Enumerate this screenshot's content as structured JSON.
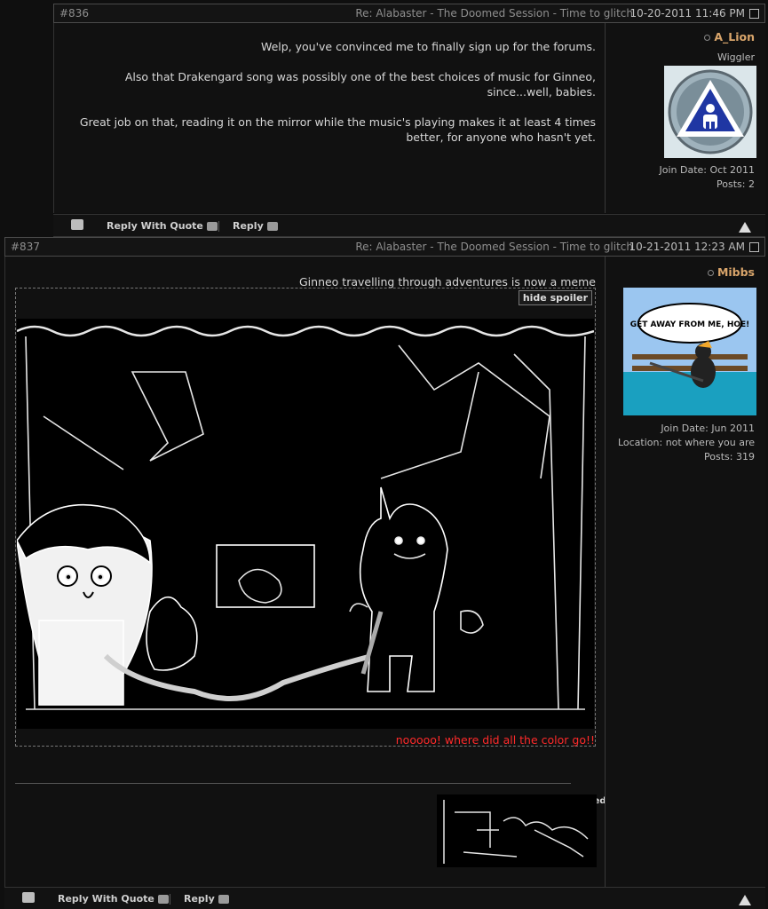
{
  "posts": [
    {
      "number": "#836",
      "datetime": "10-20-2011 11:46 PM",
      "title": "Re: Alabaster - The Doomed Session - Time to glitch",
      "message": [
        "Welp, you've convinced me to finally sign up for the forums.",
        "Also that Drakengard song was possibly one of the best choices of music for Ginneo, since...well, babies.",
        "Great job on that, reading it on the mirror while the music's playing makes it at least 4 times better, for anyone who hasn't yet."
      ],
      "user": {
        "name": "A_Lion",
        "title": "Wiggler",
        "join_label": "Join Date:",
        "join_value": "Oct 2011",
        "posts_label": "Posts:",
        "posts_value": "2"
      },
      "footer": {
        "reply": "Reply",
        "reply_quote": "Reply With Quote"
      }
    },
    {
      "number": "#837",
      "datetime": "10-21-2011 12:23 AM",
      "title": "Re: Alabaster - The Doomed Session - Time to glitch",
      "message_line": "Ginneo travelling through adventures is now a meme",
      "spoiler_button": "hide spoiler",
      "caption": "nooooo! where did all the color go!!",
      "signature_label": "kitchentrapped",
      "avatar_text": "GET AWAY FROM ME, HOE!",
      "user": {
        "name": "Mibbs",
        "join_label": "Join Date:",
        "join_value": "Jun 2011",
        "location_label": "Location:",
        "location_value": "not where you are",
        "posts_label": "Posts:",
        "posts_value": "319"
      },
      "footer": {
        "reply": "Reply",
        "reply_quote": "Reply With Quote"
      }
    }
  ],
  "colors": {
    "username": "#d9a56b",
    "caption": "#ff2a2a",
    "background": "#0f0f0f"
  },
  "icons": [
    "checkbox-icon",
    "online-status-icon",
    "reply-arrow-icon",
    "quote-icon",
    "multiquote-icon",
    "warning-icon"
  ]
}
